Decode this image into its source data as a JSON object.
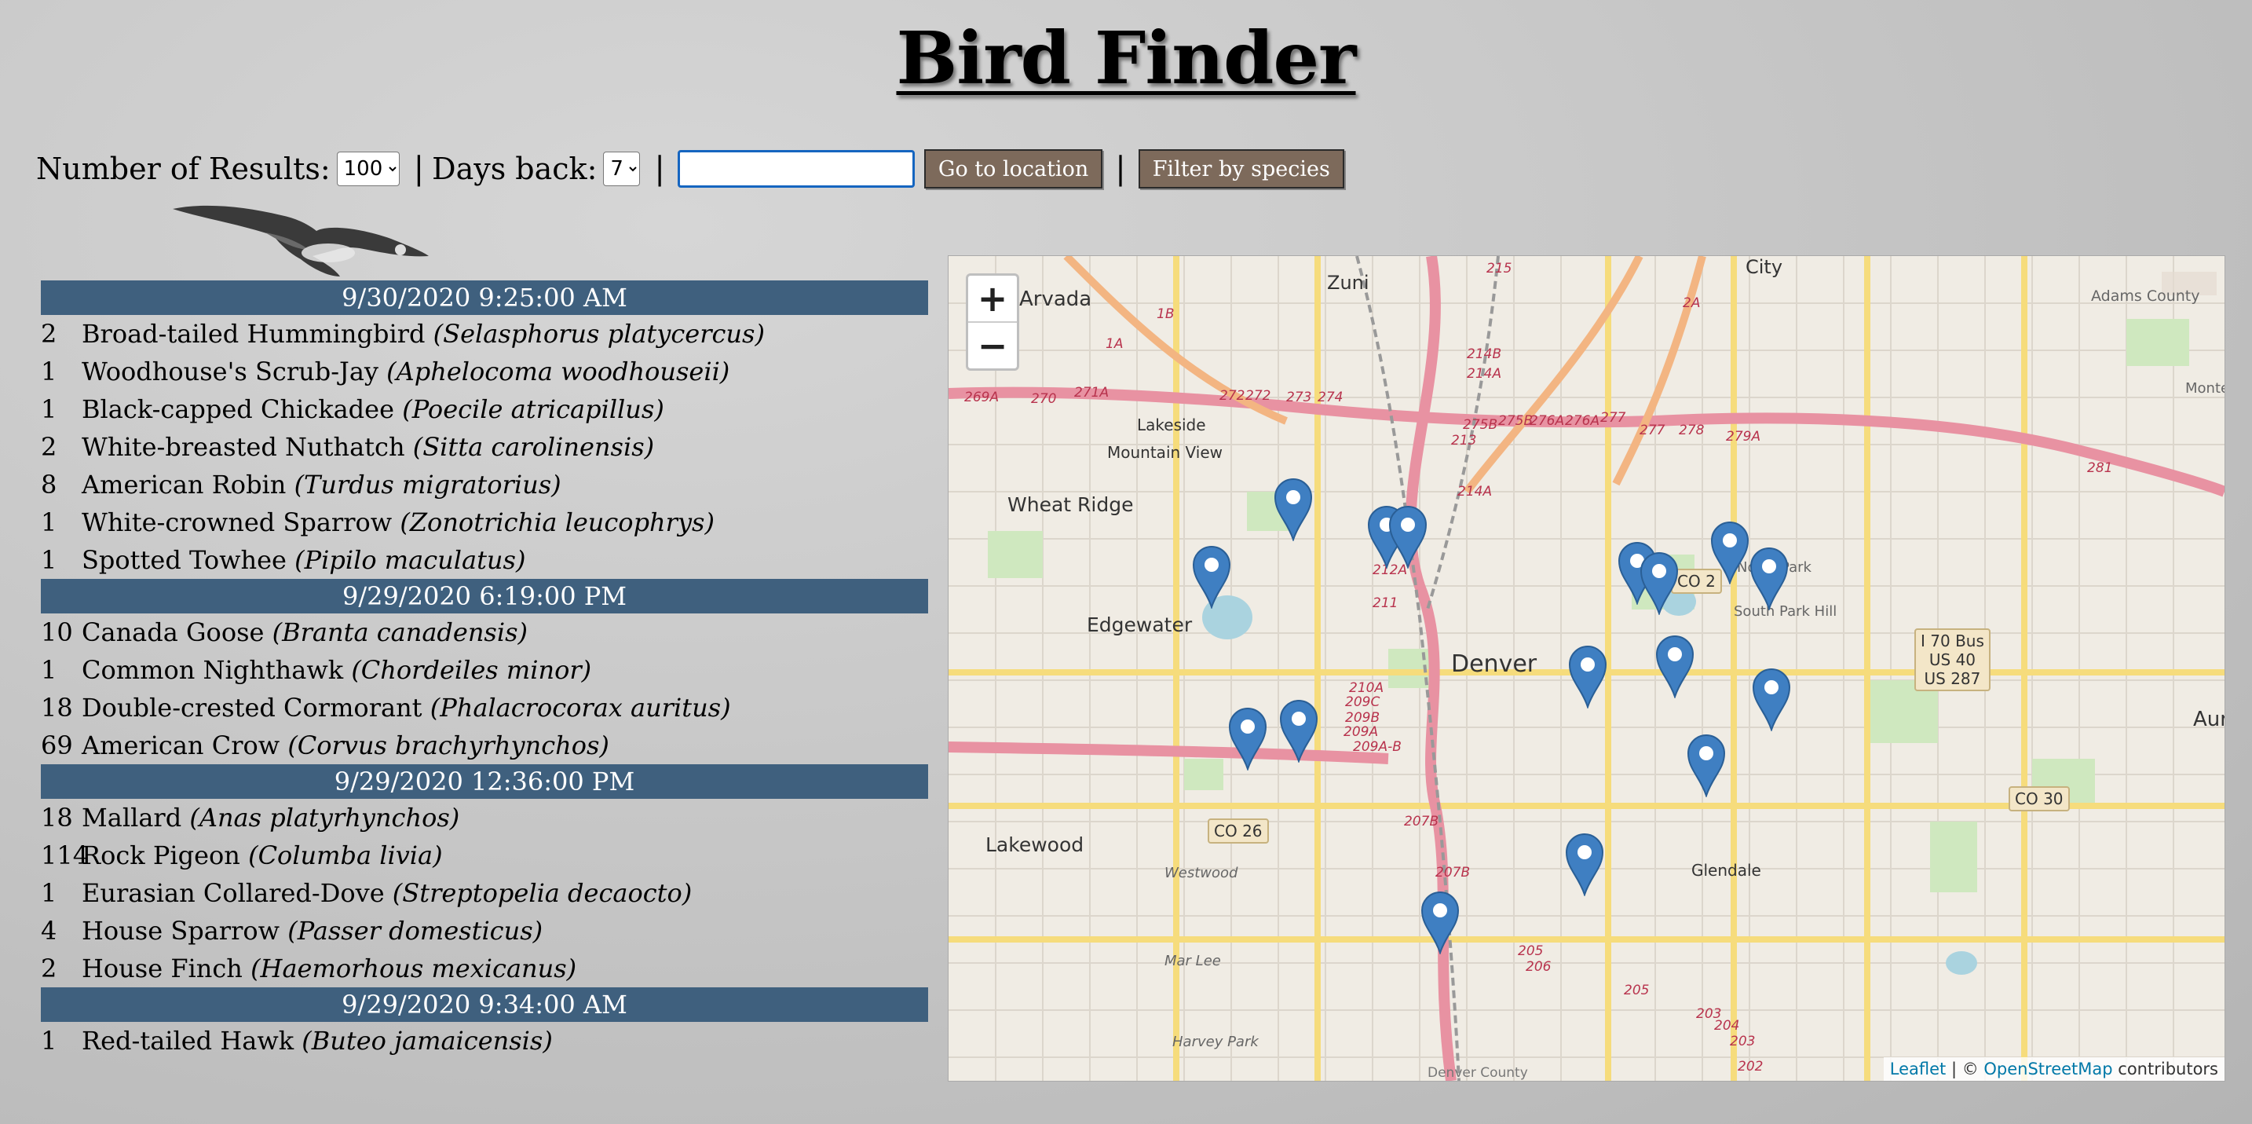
{
  "page": {
    "title": "Bird Finder"
  },
  "controls": {
    "results_label": "Number of Results:",
    "results_value": "100",
    "days_label": "Days back:",
    "days_value": "7",
    "separator": "|",
    "location_value": "",
    "go_button": "Go to location",
    "filter_button": "Filter by species"
  },
  "sightings": [
    {
      "date": "9/30/2020 9:25:00 AM",
      "birds": [
        {
          "count": "2",
          "name": "Broad-tailed Hummingbird",
          "sci": "(Selasphorus platycercus)"
        },
        {
          "count": "1",
          "name": "Woodhouse's Scrub-Jay",
          "sci": "(Aphelocoma woodhouseii)"
        },
        {
          "count": "1",
          "name": "Black-capped Chickadee",
          "sci": "(Poecile atricapillus)"
        },
        {
          "count": "2",
          "name": "White-breasted Nuthatch",
          "sci": "(Sitta carolinensis)"
        },
        {
          "count": "8",
          "name": "American Robin",
          "sci": "(Turdus migratorius)"
        },
        {
          "count": "1",
          "name": "White-crowned Sparrow",
          "sci": "(Zonotrichia leucophrys)"
        },
        {
          "count": "1",
          "name": "Spotted Towhee",
          "sci": "(Pipilo maculatus)"
        }
      ]
    },
    {
      "date": "9/29/2020 6:19:00 PM",
      "birds": [
        {
          "count": "10",
          "name": "Canada Goose",
          "sci": "(Branta canadensis)"
        },
        {
          "count": "1",
          "name": "Common Nighthawk",
          "sci": "(Chordeiles minor)"
        },
        {
          "count": "18",
          "name": "Double-crested Cormorant",
          "sci": "(Phalacrocorax auritus)"
        },
        {
          "count": "69",
          "name": "American Crow",
          "sci": "(Corvus brachyrhynchos)"
        }
      ]
    },
    {
      "date": "9/29/2020 12:36:00 PM",
      "birds": [
        {
          "count": "18",
          "name": "Mallard",
          "sci": "(Anas platyrhynchos)"
        },
        {
          "count": "114",
          "name": "Rock Pigeon",
          "sci": "(Columba livia)"
        },
        {
          "count": "1",
          "name": "Eurasian Collared-Dove",
          "sci": "(Streptopelia decaocto)"
        },
        {
          "count": "4",
          "name": "House Sparrow",
          "sci": "(Passer domesticus)"
        },
        {
          "count": "2",
          "name": "House Finch",
          "sci": "(Haemorhous mexicanus)"
        }
      ]
    },
    {
      "date": "9/29/2020 9:34:00 AM",
      "birds": [
        {
          "count": "1",
          "name": "Red-tailed Hawk",
          "sci": "(Buteo jamaicensis)"
        }
      ]
    }
  ],
  "map": {
    "zoom_in": "+",
    "zoom_out": "−",
    "attribution": {
      "leaflet": "Leaflet",
      "sep": " | © ",
      "osm": "OpenStreetMap",
      "contrib": " contributors"
    },
    "places": {
      "denver": "Denver",
      "arvada": "Arvada",
      "wheat_ridge": "Wheat Ridge",
      "edgewater": "Edgewater",
      "lakewood": "Lakewood",
      "glendale": "Glendale",
      "aurora": "Aurora",
      "city": "City",
      "lakeside": "Lakeside",
      "mountain_view": "Mountain View",
      "adams_county": "Adams County",
      "westwood": "Westwood",
      "mar_lee": "Mar Lee",
      "harvey_park": "Harvey Park",
      "denver_county": "Denver County",
      "south_park_hill": "South Park Hill",
      "north_park": "North Park",
      "montebe": "Montebe",
      "zuni": "Zuni"
    },
    "shields": {
      "co26": "CO 26",
      "co30": "CO 30",
      "co2": "CO 2",
      "i70_l1": "I 70 Bus",
      "i70_l2": "US 40",
      "i70_l3": "US 287"
    },
    "exits": [
      "215",
      "1B",
      "1A",
      "269A",
      "270",
      "271A",
      "272",
      "272",
      "273",
      "274",
      "275B",
      "275B",
      "276A",
      "276A",
      "277",
      "277",
      "278",
      "279A",
      "281",
      "213",
      "214B",
      "214A",
      "212A",
      "211",
      "210A",
      "209C",
      "209B",
      "209A",
      "209A-B",
      "207B",
      "207B",
      "205",
      "206",
      "205",
      "203",
      "204",
      "203",
      "202",
      "2A",
      "214A"
    ]
  }
}
